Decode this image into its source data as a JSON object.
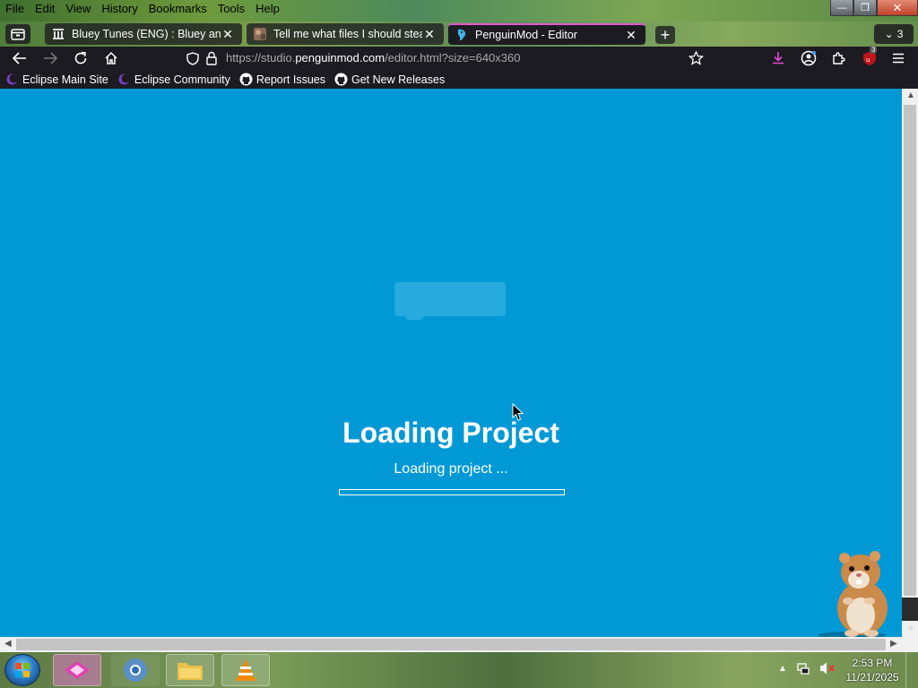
{
  "menu": {
    "items": [
      "File",
      "Edit",
      "View",
      "History",
      "Bookmarks",
      "Tools",
      "Help"
    ]
  },
  "tabs": [
    {
      "title": "Bluey Tunes (ENG) : Bluey and A",
      "icon": "archive-icon",
      "active": false
    },
    {
      "title": "Tell me what files I should steal",
      "icon": "thumbnail-icon",
      "active": false
    },
    {
      "title": "PenguinMod - Editor",
      "icon": "penguinmod-icon",
      "active": true
    }
  ],
  "tab_count": "3",
  "address": {
    "prefix": "https://studio.",
    "domain": "penguinmod.com",
    "path": "/editor.html?size=640x360"
  },
  "extension_badge": "3",
  "bookmarks": [
    {
      "label": "Eclipse Main Site",
      "icon": "eclipse-icon"
    },
    {
      "label": "Eclipse Community",
      "icon": "eclipse-icon"
    },
    {
      "label": "Report Issues",
      "icon": "github-icon"
    },
    {
      "label": "Get New Releases",
      "icon": "github-icon"
    }
  ],
  "loading": {
    "title": "Loading Project",
    "status": "Loading project ...",
    "progress": 0
  },
  "clock": {
    "time": "2:53 PM",
    "date": "11/21/2025"
  },
  "colors": {
    "content_bg": "#0099d6",
    "active_tab_accent": "#e05cd0",
    "browser_chrome": "#1c1b22"
  }
}
